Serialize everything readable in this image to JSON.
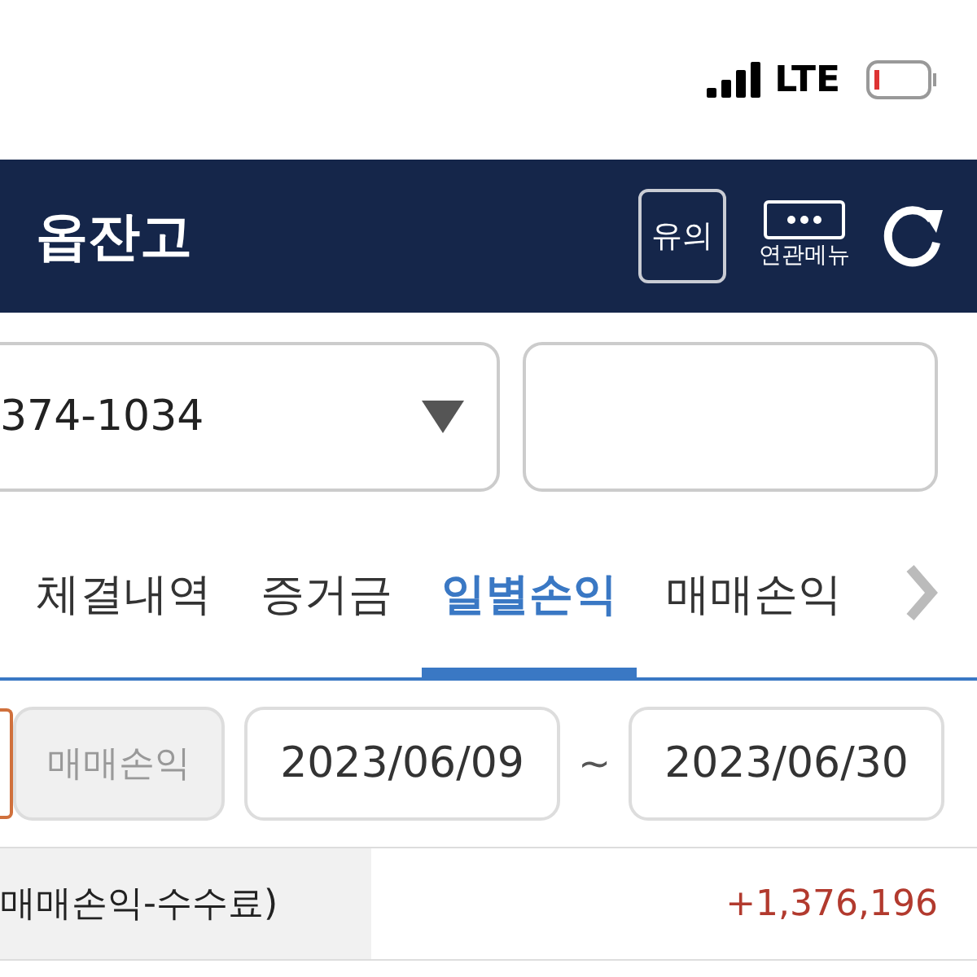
{
  "status_bar": {
    "network": "LTE"
  },
  "header": {
    "title": "옵잔고",
    "notice_button": "유의",
    "menu_button": "연관메뉴"
  },
  "account": {
    "number": "374-1034"
  },
  "tabs": [
    {
      "label": "체결내역",
      "selected": false
    },
    {
      "label": "증거금",
      "selected": false
    },
    {
      "label": "일별손익",
      "selected": true
    },
    {
      "label": "매매손익",
      "selected": false
    }
  ],
  "filter": {
    "type_button": "매매손익",
    "start_date": "2023/06/09",
    "separator": "~",
    "end_date": "2023/06/30"
  },
  "summary": {
    "label": "매매손익-수수료)",
    "value": "+1,376,196"
  }
}
